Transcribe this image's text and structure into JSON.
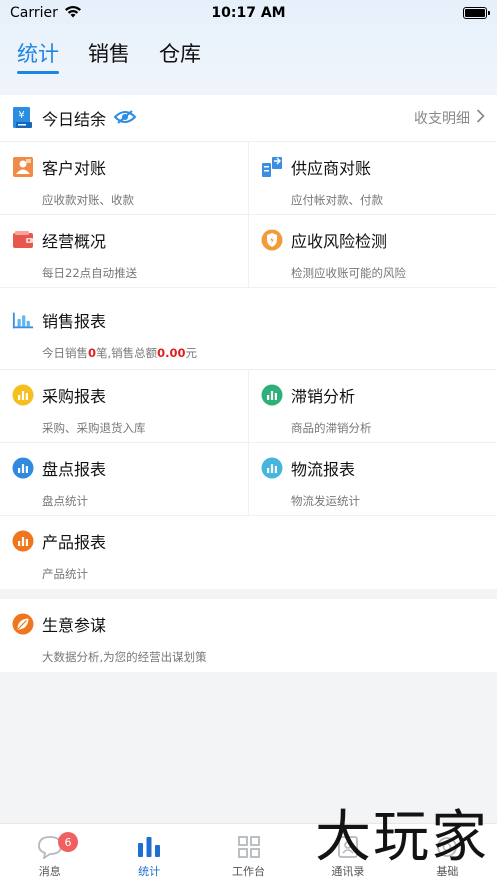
{
  "status": {
    "carrier": "Carrier",
    "time": "10:17 AM"
  },
  "top_tabs": [
    {
      "label": "统计"
    },
    {
      "label": "销售"
    },
    {
      "label": "仓库"
    }
  ],
  "today_section": {
    "title": "今日结余",
    "detail_link": "收支明细"
  },
  "items": {
    "customer": {
      "title": "客户对账",
      "sub": "应收款对账、收款"
    },
    "supplier": {
      "title": "供应商对账",
      "sub": "应付帐对款、付款"
    },
    "operations": {
      "title": "经营概况",
      "sub": "每日22点自动推送"
    },
    "risk": {
      "title": "应收风险检测",
      "sub": "检测应收账可能的风险"
    },
    "sales": {
      "title": "销售报表",
      "sub_prefix": "今日销售",
      "count": "0",
      "sub_mid": "笔,销售总额",
      "amount": "0.00",
      "sub_suffix": "元"
    },
    "purchase": {
      "title": "采购报表",
      "sub": "采购、采购退货入库"
    },
    "slow": {
      "title": "滞销分析",
      "sub": "商品的滞销分析"
    },
    "inventory": {
      "title": "盘点报表",
      "sub": "盘点统计"
    },
    "logistics": {
      "title": "物流报表",
      "sub": "物流发运统计"
    },
    "product": {
      "title": "产品报表",
      "sub": "产品统计"
    },
    "advisor": {
      "title": "生意参谋",
      "sub": "大数据分析,为您的经营出谋划策"
    }
  },
  "tabbar": [
    {
      "label": "消息",
      "badge": "6"
    },
    {
      "label": "统计"
    },
    {
      "label": "工作台"
    },
    {
      "label": "通讯录"
    },
    {
      "label": "基础"
    }
  ],
  "watermark": "大玩家",
  "colors": {
    "accent": "#1f86e0",
    "amount_red": "#e02020"
  },
  "icons": [
    "wifi-icon",
    "battery-icon",
    "receipt-icon",
    "eye-icon",
    "chevron-right-icon",
    "customer-icon",
    "supplier-icon",
    "wallet-icon",
    "shield-icon",
    "bar-chart-icon",
    "leaf-icon",
    "chat-icon",
    "stats-icon",
    "grid-icon",
    "contacts-icon",
    "settings-icon"
  ]
}
